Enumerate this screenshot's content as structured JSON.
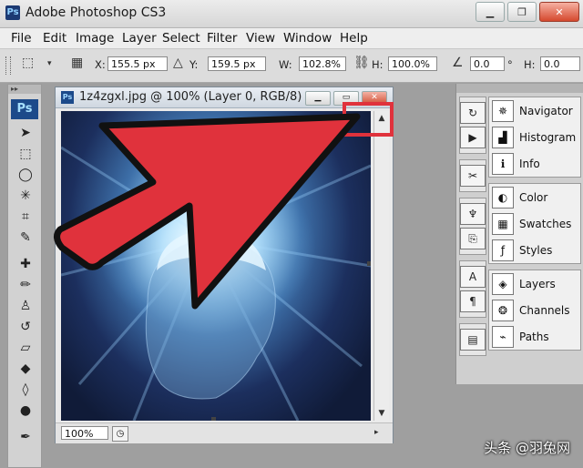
{
  "window": {
    "title": "Adobe Photoshop CS3",
    "app_icon": "Ps",
    "buttons": [
      "minimize-icon",
      "restore-icon",
      "close-icon"
    ]
  },
  "menu": {
    "items": [
      "File",
      "Edit",
      "Image",
      "Layer",
      "Select",
      "Filter",
      "View",
      "Window",
      "Help"
    ]
  },
  "options": {
    "x_label": "X:",
    "x_value": "155.5 px",
    "y_label": "Y:",
    "y_value": "159.5 px",
    "w_label": "W:",
    "w_value": "102.8%",
    "h_label": "H:",
    "h_value": "100.0%",
    "angle_value": "0.0",
    "degree_symbol": "°",
    "hskew_label": "H:",
    "hskew_value": "0.0"
  },
  "tools": {
    "logo": "Ps",
    "icons": [
      "move-tool-icon",
      "marquee-tool-icon",
      "lasso-tool-icon",
      "magic-wand-icon",
      "crop-tool-icon",
      "slice-tool-icon",
      "healing-brush-icon",
      "brush-tool-icon",
      "clone-stamp-icon",
      "history-brush-icon",
      "eraser-icon",
      "paint-bucket-icon",
      "blur-tool-icon",
      "dodge-tool-icon",
      "pen-tool-icon"
    ]
  },
  "document": {
    "title": "1z4zgxl.jpg @ 100% (Layer 0, RGB/8)",
    "zoom": "100%"
  },
  "panels": {
    "group1": [
      "Navigator",
      "Histogram",
      "Info"
    ],
    "group2": [
      "Color",
      "Swatches",
      "Styles"
    ],
    "group3": [
      "Layers",
      "Channels",
      "Paths"
    ]
  },
  "annotation": {
    "arrow_color": "#e0323c",
    "highlight_color": "#e0323c"
  },
  "watermark": "头条 @羽兔网"
}
